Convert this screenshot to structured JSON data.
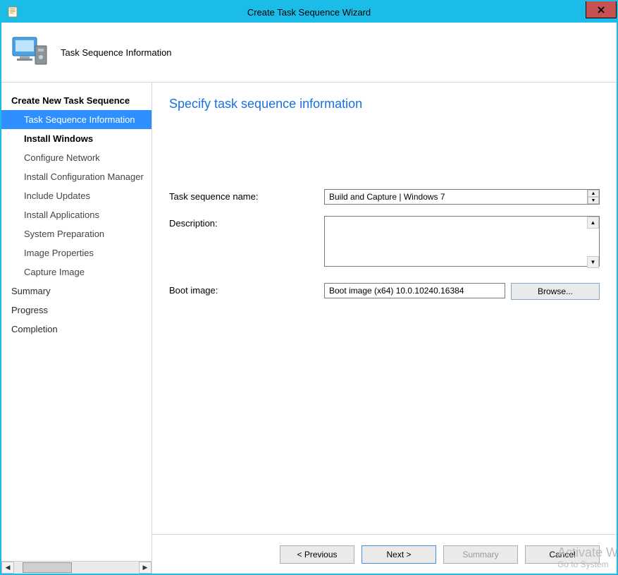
{
  "window": {
    "title": "Create Task Sequence Wizard"
  },
  "header": {
    "title": "Task Sequence Information"
  },
  "sidebar": {
    "items": [
      {
        "label": "Create New Task Sequence",
        "level": 0,
        "bold": true,
        "selected": false
      },
      {
        "label": "Task Sequence Information",
        "level": 1,
        "bold": false,
        "selected": true
      },
      {
        "label": "Install Windows",
        "level": 1,
        "bold": true,
        "selected": false
      },
      {
        "label": "Configure Network",
        "level": 1,
        "bold": false,
        "selected": false
      },
      {
        "label": "Install Configuration Manager",
        "level": 1,
        "bold": false,
        "selected": false
      },
      {
        "label": "Include Updates",
        "level": 1,
        "bold": false,
        "selected": false
      },
      {
        "label": "Install Applications",
        "level": 1,
        "bold": false,
        "selected": false
      },
      {
        "label": "System Preparation",
        "level": 1,
        "bold": false,
        "selected": false
      },
      {
        "label": "Image Properties",
        "level": 1,
        "bold": false,
        "selected": false
      },
      {
        "label": "Capture Image",
        "level": 1,
        "bold": false,
        "selected": false
      },
      {
        "label": "Summary",
        "level": 0,
        "bold": false,
        "selected": false
      },
      {
        "label": "Progress",
        "level": 0,
        "bold": false,
        "selected": false
      },
      {
        "label": "Completion",
        "level": 0,
        "bold": false,
        "selected": false
      }
    ]
  },
  "main": {
    "page_title": "Specify task sequence information",
    "labels": {
      "task_sequence_name": "Task sequence name:",
      "description": "Description:",
      "boot_image": "Boot image:"
    },
    "values": {
      "task_sequence_name": "Build and Capture | Windows 7",
      "description": "",
      "boot_image": "Boot image (x64) 10.0.10240.16384"
    },
    "buttons": {
      "browse": "Browse..."
    }
  },
  "footer": {
    "previous": "< Previous",
    "next": "Next >",
    "summary": "Summary",
    "cancel": "Cancel"
  },
  "watermark": {
    "line1": "Activate W",
    "line2": "Go to System"
  }
}
